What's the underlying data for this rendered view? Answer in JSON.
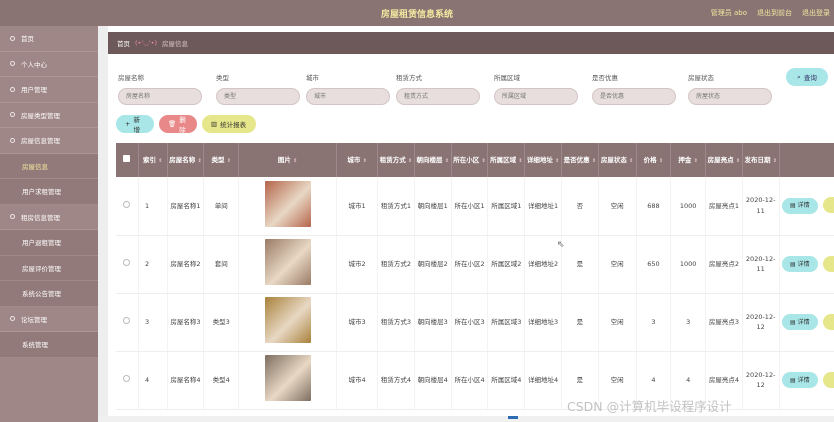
{
  "app": {
    "title": "房屋租赁信息系统",
    "admin": "管理员 abo",
    "back": "退出到前台",
    "logout": "退出登录"
  },
  "sidebar": {
    "items": [
      {
        "label": "首页",
        "sub": false,
        "active": false
      },
      {
        "label": "个人中心",
        "sub": false,
        "active": false
      },
      {
        "label": "用户管理",
        "sub": false,
        "active": false
      },
      {
        "label": "房屋类型管理",
        "sub": false,
        "active": false
      },
      {
        "label": "房屋信息管理",
        "sub": false,
        "active": false
      },
      {
        "label": "房屋信息",
        "sub": true,
        "active": true
      },
      {
        "label": "用户求租管理",
        "sub": true,
        "active": false
      },
      {
        "label": "租房信息管理",
        "sub": false,
        "active": false
      },
      {
        "label": "用户退租管理",
        "sub": true,
        "active": false
      },
      {
        "label": "房屋评价管理",
        "sub": true,
        "active": false
      },
      {
        "label": "系统公告管理",
        "sub": true,
        "active": false
      },
      {
        "label": "论坛管理",
        "sub": false,
        "active": false
      },
      {
        "label": "系统管理",
        "sub": true,
        "active": false
      }
    ]
  },
  "breadcrumb": {
    "home": "首页",
    "sep": "(•'◡'•)",
    "current": "房屋信息"
  },
  "search": {
    "fields": [
      {
        "label": "房屋名称",
        "placeholder": "房屋名称"
      },
      {
        "label": "类型",
        "placeholder": "类型"
      },
      {
        "label": "城市",
        "placeholder": "城市"
      },
      {
        "label": "租赁方式",
        "placeholder": "租赁方式"
      },
      {
        "label": "所属区域",
        "placeholder": "所属区域"
      },
      {
        "label": "是否优惠",
        "placeholder": "是否优惠"
      },
      {
        "label": "房屋状态",
        "placeholder": "房屋状态"
      }
    ],
    "query_label": "查询"
  },
  "actions": {
    "add": "新增",
    "delete": "删除",
    "report": "统计报表"
  },
  "table": {
    "headers": [
      "索引",
      "房屋名称",
      "类型",
      "图片",
      "城市",
      "租赁方式",
      "朝向楼层",
      "所在小区",
      "所属区域",
      "详细地址",
      "是否优惠",
      "房屋状态",
      "价格",
      "押金",
      "房屋亮点",
      "发布日期"
    ],
    "detail_label": "详情",
    "rows": [
      {
        "idx": "1",
        "name": "房屋名称1",
        "type": "单间",
        "city": "城市1",
        "lease": "租赁方式1",
        "floor": "朝向楼层1",
        "community": "所在小区1",
        "area": "所属区域1",
        "address": "详细地址1",
        "discount": "否",
        "status": "空闲",
        "price": "688",
        "deposit": "1000",
        "highlight": "房屋亮点1",
        "date": "2020-12-11",
        "photo": "#b5644a"
      },
      {
        "idx": "2",
        "name": "房屋名称2",
        "type": "套间",
        "city": "城市2",
        "lease": "租赁方式2",
        "floor": "朝向楼层2",
        "community": "所在小区2",
        "area": "所属区域2",
        "address": "详细地址2",
        "discount": "是",
        "status": "空闲",
        "price": "650",
        "deposit": "1000",
        "highlight": "房屋亮点2",
        "date": "2020-12-11",
        "photo": "#9a7b66"
      },
      {
        "idx": "3",
        "name": "房屋名称3",
        "type": "类型3",
        "city": "城市3",
        "lease": "租赁方式3",
        "floor": "朝向楼层3",
        "community": "所在小区3",
        "area": "所属区域3",
        "address": "详细地址3",
        "discount": "是",
        "status": "空闲",
        "price": "3",
        "deposit": "3",
        "highlight": "房屋亮点3",
        "date": "2020-12-12",
        "photo": "#a8823a"
      },
      {
        "idx": "4",
        "name": "房屋名称4",
        "type": "类型4",
        "city": "城市4",
        "lease": "租赁方式4",
        "floor": "朝向楼层4",
        "community": "所在小区4",
        "area": "所属区域4",
        "address": "详细地址4",
        "discount": "是",
        "status": "空闲",
        "price": "4",
        "deposit": "4",
        "highlight": "房屋亮点4",
        "date": "2020-12-12",
        "photo": "#7e6e60"
      }
    ]
  },
  "watermark": "CSDN @计算机毕设程序设计"
}
